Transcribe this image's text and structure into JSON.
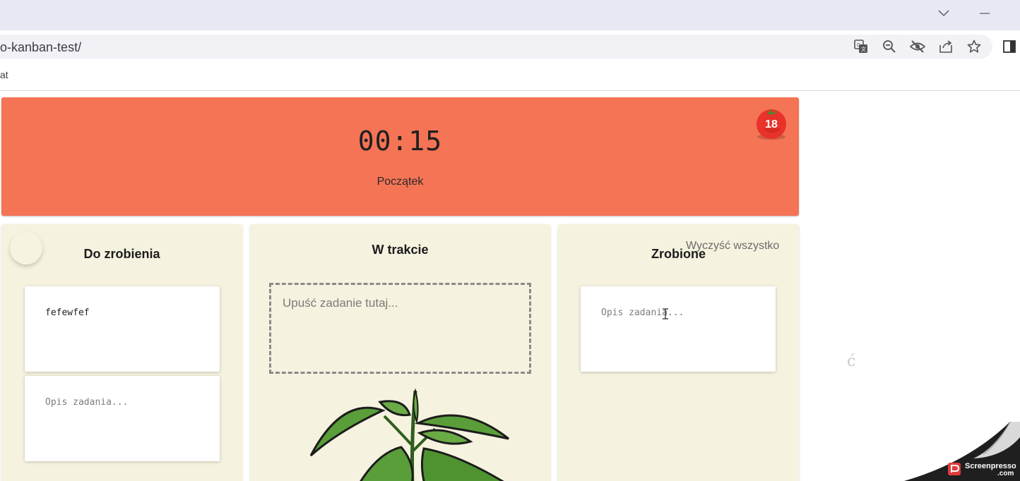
{
  "browser": {
    "url": "o-kanban-test/",
    "bookmark_fragment": "at",
    "icons": [
      "translate-icon",
      "zoom-out-icon",
      "eye-off-icon",
      "share-icon",
      "star-icon",
      "side-panel-icon",
      "chevron-down-icon",
      "minimize-icon"
    ]
  },
  "pomodoro": {
    "time": "00:15",
    "status": "Początek",
    "tomato_count": "18",
    "bg_color": "#f47455"
  },
  "columns": {
    "todo": {
      "title": "Do zrobienia",
      "cards": [
        {
          "text": "fefewfef"
        },
        {
          "placeholder": "Opis zadania..."
        }
      ]
    },
    "in_progress": {
      "title": "W trakcie",
      "dropzone_text": "Upuść zadanie tutaj..."
    },
    "done": {
      "title": "Zrobione",
      "clear_all": "Wyczyść wszystko",
      "cards": [
        {
          "placeholder": "Opis zadania..."
        }
      ]
    }
  },
  "side_glyph": "ć",
  "watermark": {
    "line1": "Screenpresso",
    "line2": ".com"
  }
}
